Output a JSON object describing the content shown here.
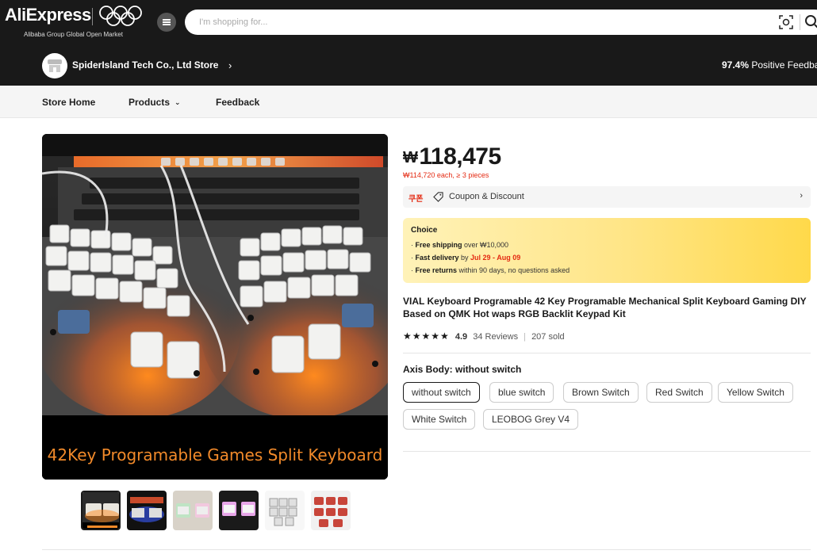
{
  "header": {
    "logo_text": "AliExpress",
    "logo_subtitle": "Alibaba Group Global Open Market",
    "search_placeholder": "I'm shopping for..."
  },
  "store": {
    "name": "SpiderIsland Tech Co., Ltd Store",
    "positive_feedback_pct": "97.4%",
    "positive_feedback_label": "Positive Feedba"
  },
  "nav": {
    "items": [
      "Store Home",
      "Products",
      "Feedback"
    ]
  },
  "gallery": {
    "banner_caption": "42Key Programable Games Split Keyboard",
    "thumbnail_count": 6,
    "active_thumbnail": 1
  },
  "product": {
    "currency_symbol": "₩",
    "price": "118,475",
    "bulk_price": "₩114,720 each, ≥ 3 pieces",
    "coupon_badge": "쿠폰",
    "coupon_label": "Coupon & Discount",
    "choice": {
      "title": "Choice",
      "line1_bold": "Free shipping",
      "line1_rest": " over ₩10,000",
      "line2_bold": "Fast delivery",
      "line2_mid": " by ",
      "line2_red": "Jul 29 - Aug 09",
      "line3_bold": "Free returns",
      "line3_rest": "  within 90 days, no questions asked"
    },
    "title": "VIAL Keyboard Programable 42 Key Programable Mechanical Split Keyboard Gaming DIY Based on QMK Hot waps RGB Backlit Keypad Kit",
    "stars": "★★★★★",
    "rating": "4.9",
    "reviews": "34 Reviews",
    "sold": "207 sold",
    "axis_label": "Axis Body: without switch",
    "options": [
      "without switch",
      "blue switch",
      "Brown Switch",
      "Red Switch",
      "Yellow Switch",
      "White Switch",
      "LEOBOG Grey V4"
    ],
    "selected_option": "without switch"
  },
  "colors": {
    "header_bg": "#191919",
    "accent_red": "#e42a12",
    "choice_yellow": "#ffe586"
  }
}
